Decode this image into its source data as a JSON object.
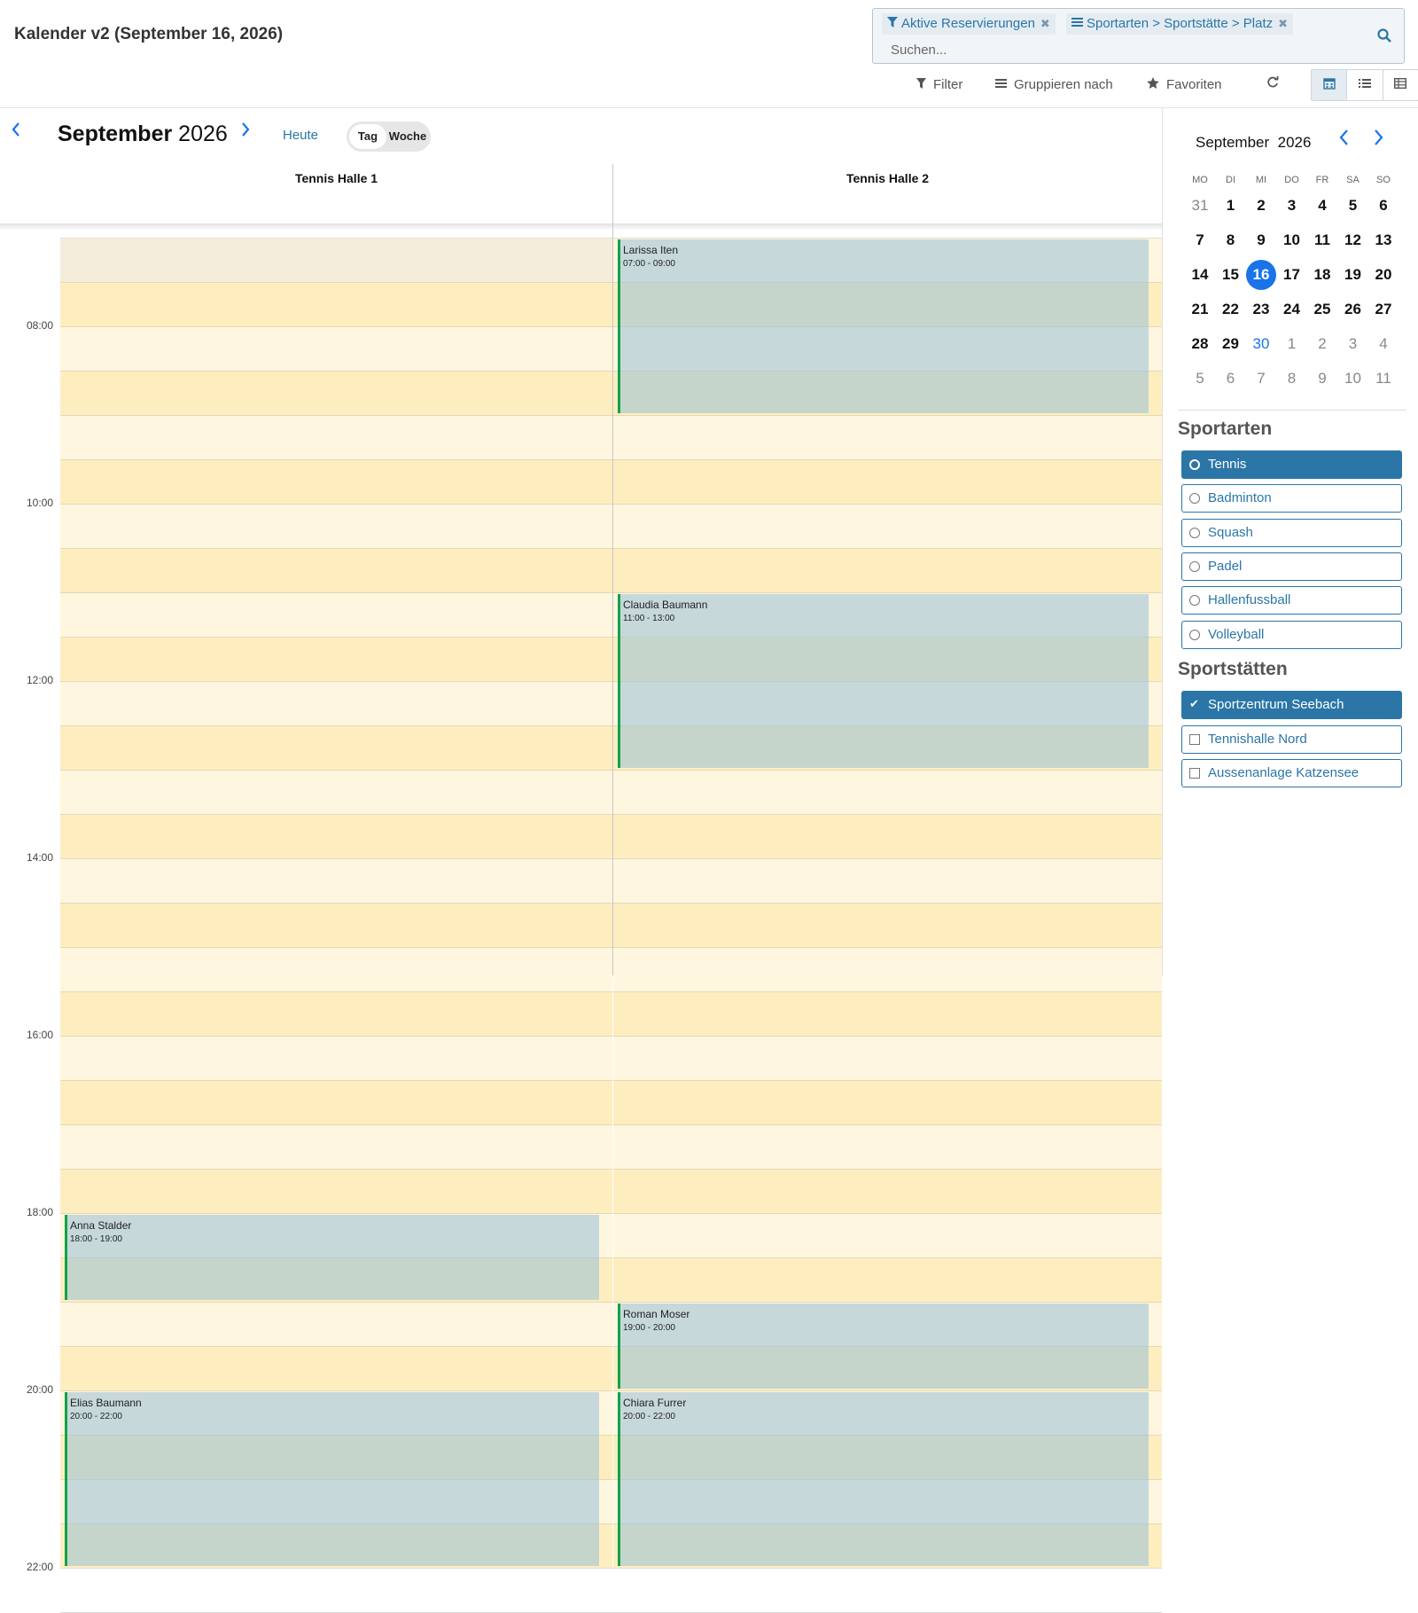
{
  "header": {
    "title": "Kalender v2 (September 16, 2026)",
    "search": {
      "facets": [
        {
          "icon": "filter-icon",
          "label": "Aktive Reservierungen"
        },
        {
          "icon": "group-icon",
          "label": "Sportarten  > Sportstätte  > Platz"
        }
      ],
      "placeholder": "Suchen..."
    },
    "controls": {
      "filter": "Filter",
      "group_by": "Gruppieren nach",
      "favorites": "Favoriten"
    },
    "views": [
      "calendar",
      "list",
      "pivot"
    ]
  },
  "calendar": {
    "month": "September",
    "year": "2026",
    "today_label": "Heute",
    "scales": [
      "Tag",
      "Woche"
    ],
    "active_scale": "Tag",
    "columns": [
      "Tennis Halle 1",
      "Tennis Halle 2"
    ],
    "time_labels": [
      "08:00",
      "10:00",
      "12:00",
      "14:00",
      "16:00",
      "18:00",
      "20:00",
      "22:00"
    ],
    "events": [
      {
        "column": 1,
        "name": "Larissa Iten",
        "time": "07:00 - 09:00",
        "start": 7,
        "end": 9
      },
      {
        "column": 1,
        "name": "Claudia Baumann",
        "time": "11:00 - 13:00",
        "start": 11,
        "end": 13
      },
      {
        "column": 0,
        "name": "Anna Stalder",
        "time": "18:00 - 19:00",
        "start": 18,
        "end": 19
      },
      {
        "column": 1,
        "name": "Roman Moser",
        "time": "19:00 - 20:00",
        "start": 19,
        "end": 20
      },
      {
        "column": 0,
        "name": "Elias Baumann",
        "time": "20:00 - 22:00",
        "start": 20,
        "end": 22
      },
      {
        "column": 1,
        "name": "Chiara Furrer",
        "time": "20:00 - 22:00",
        "start": 20,
        "end": 22
      }
    ]
  },
  "mini_calendar": {
    "month": "September",
    "year": "2026",
    "weekdays": [
      "MO",
      "DI",
      "MI",
      "DO",
      "FR",
      "SA",
      "SO"
    ],
    "weeks": [
      [
        "31",
        "1",
        "2",
        "3",
        "4",
        "5",
        "6"
      ],
      [
        "7",
        "8",
        "9",
        "10",
        "11",
        "12",
        "13"
      ],
      [
        "14",
        "15",
        "16",
        "17",
        "18",
        "19",
        "20"
      ],
      [
        "21",
        "22",
        "23",
        "24",
        "25",
        "26",
        "27"
      ],
      [
        "28",
        "29",
        "30",
        "1",
        "2",
        "3",
        "4"
      ],
      [
        "5",
        "6",
        "7",
        "8",
        "9",
        "10",
        "11"
      ]
    ],
    "selected": "16",
    "today": "30"
  },
  "filters": {
    "sportarten_title": "Sportarten",
    "sportarten": [
      {
        "label": "Tennis",
        "active": true
      },
      {
        "label": "Badminton",
        "active": false
      },
      {
        "label": "Squash",
        "active": false
      },
      {
        "label": "Padel",
        "active": false
      },
      {
        "label": "Hallenfussball",
        "active": false
      },
      {
        "label": "Volleyball",
        "active": false
      }
    ],
    "sportstaetten_title": "Sportstätten",
    "sportstaetten": [
      {
        "label": "Sportzentrum Seebach",
        "checked": true
      },
      {
        "label": "Tennishalle Nord",
        "checked": false
      },
      {
        "label": "Aussenanlage Katzensee",
        "checked": false
      }
    ]
  },
  "colors": {
    "accent": "#2b76a7",
    "link_blue": "#1a73e8",
    "slot_light": "#fff6e0",
    "slot_dark": "#feeebf",
    "slot_past": "#f4eddb",
    "event_bar": "#12a24a"
  }
}
